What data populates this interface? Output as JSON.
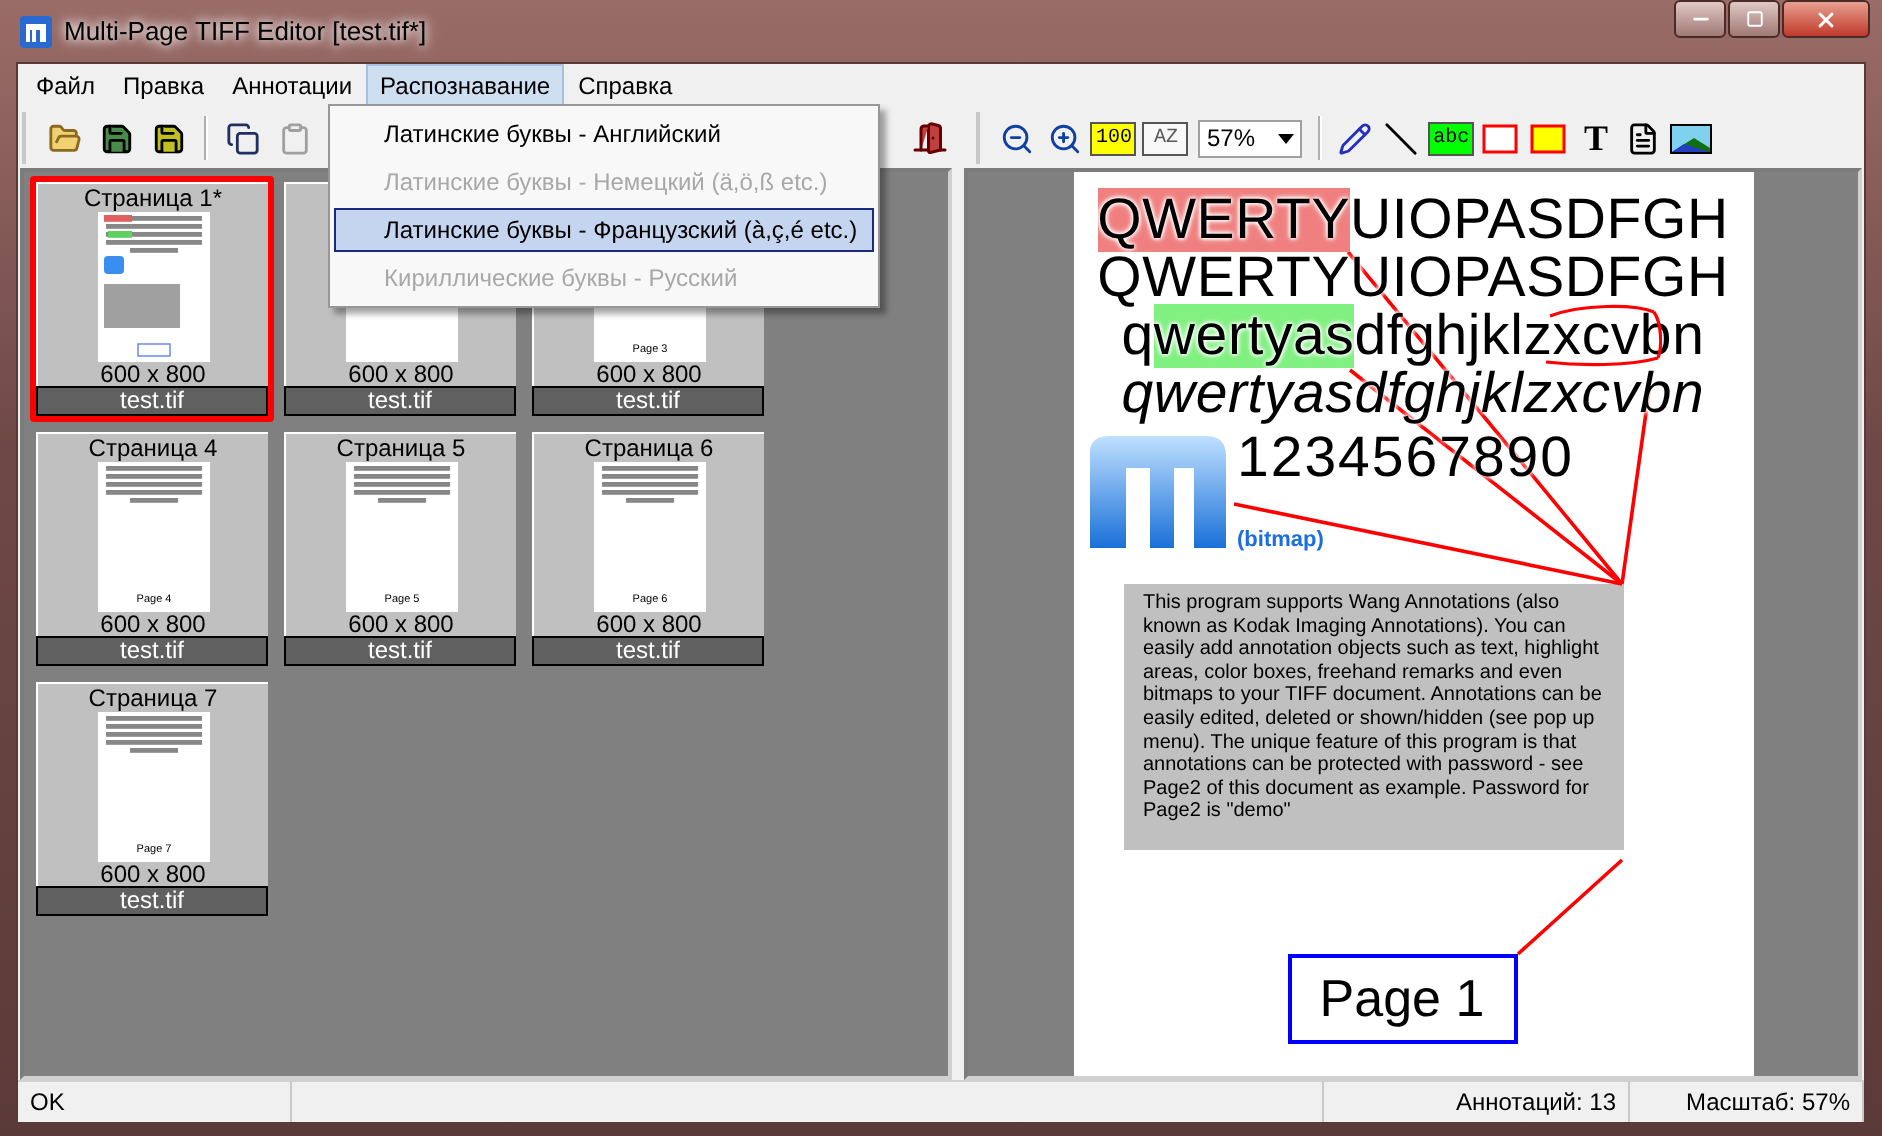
{
  "window": {
    "title": "Multi-Page TIFF Editor [test.tif*]"
  },
  "menu": [
    {
      "label": "Файл",
      "selected": false
    },
    {
      "label": "Правка",
      "selected": false
    },
    {
      "label": "Аннотации",
      "selected": false
    },
    {
      "label": "Распознавание",
      "selected": true
    },
    {
      "label": "Справка",
      "selected": false
    }
  ],
  "dropdown": [
    {
      "label": "Латинские буквы - Английский",
      "disabled": false,
      "selected": false
    },
    {
      "label": "Латинские буквы - Немецкий (ä,ö,ß etc.)",
      "disabled": true,
      "selected": false
    },
    {
      "label": "Латинские буквы - Французский (à,ç,é etc.)",
      "disabled": false,
      "selected": true
    },
    {
      "label": "Кириллические буквы - Русский",
      "disabled": true,
      "selected": false
    }
  ],
  "left_toolbar": [
    {
      "kind": "open",
      "disabled": false
    },
    {
      "kind": "save",
      "disabled": false
    },
    {
      "kind": "save-all",
      "disabled": false
    },
    {
      "kind": "copy",
      "disabled": false
    },
    {
      "kind": "paste",
      "disabled": true
    }
  ],
  "right_toolbar": [
    {
      "kind": "zoom-out",
      "disabled": false
    },
    {
      "kind": "zoom-in",
      "disabled": false
    },
    {
      "kind": "actual-size",
      "label": "100",
      "disabled": false
    },
    {
      "kind": "fit",
      "label": "AZ",
      "disabled": true
    },
    {
      "kind": "combo",
      "value": "57%",
      "disabled": false
    },
    {
      "kind": "pen",
      "disabled": false
    },
    {
      "kind": "line",
      "disabled": false
    },
    {
      "kind": "highlight",
      "label": "abc",
      "disabled": false
    },
    {
      "kind": "hollow-rect",
      "disabled": false
    },
    {
      "kind": "filled-rect",
      "disabled": false
    },
    {
      "kind": "text",
      "label": "T",
      "disabled": false
    },
    {
      "kind": "note",
      "disabled": false
    },
    {
      "kind": "image",
      "disabled": false
    }
  ],
  "thumbnails": [
    {
      "title": "Страница 1*",
      "size": "600 x 800",
      "file": "test.tif",
      "selected": true,
      "kind": "annotated"
    },
    {
      "size": "600 x 800",
      "file": "test.tif",
      "selected": false,
      "kind": "plain"
    },
    {
      "caption": "Page 3",
      "size": "600 x 800",
      "file": "test.tif",
      "selected": false,
      "kind": "plain"
    },
    {
      "title": "Страница 4",
      "caption": "Page 4",
      "size": "600 x 800",
      "file": "test.tif",
      "selected": false,
      "kind": "plain"
    },
    {
      "title": "Страница 5",
      "caption": "Page 5",
      "size": "600 x 800",
      "file": "test.tif",
      "selected": false,
      "kind": "plain"
    },
    {
      "title": "Страница 6",
      "caption": "Page 6",
      "size": "600 x 800",
      "file": "test.tif",
      "selected": false,
      "kind": "plain"
    },
    {
      "title": "Страница 7",
      "caption": "Page 7",
      "size": "600 x 800",
      "file": "test.tif",
      "selected": false,
      "kind": "plain"
    }
  ],
  "document": {
    "rows": [
      {
        "kind": "plain",
        "segments": [
          {
            "text": "QWERTY",
            "kind": "highlight",
            "color": "#f08080"
          },
          {
            "text": "UIOPASDFGH",
            "kind": "plain"
          }
        ]
      },
      {
        "kind": "plain",
        "segments": [
          {
            "text": "QWERTYUIOPASDFGH",
            "kind": "plain"
          }
        ]
      },
      {
        "kind": "plain",
        "segments": [
          {
            "text": "q",
            "kind": "plain"
          },
          {
            "text": "wertyas",
            "kind": "highlight",
            "color": "#80f080"
          },
          {
            "text": "dfghjklz",
            "kind": "plain"
          },
          {
            "text": "xcvb",
            "kind": "scribble"
          },
          {
            "text": "n",
            "kind": "plain"
          }
        ]
      },
      {
        "kind": "italic",
        "segments": [
          {
            "text": "qwertyasdfghjklzxcvbn",
            "kind": "plain"
          }
        ]
      }
    ],
    "digits": "1234567890",
    "bitmap_caption": "(bitmap)",
    "note": "This program supports Wang Annotations (also known as Kodak Imaging Annotations). You can easily add annotation objects such as text, highlight areas, color boxes, freehand remarks and even bitmaps to your TIFF document. Annotations can be easily edited, deleted or shown/hidden (see pop up menu). The unique feature of this program is that annotations can be protected with password - see Page2 of this document as example. Password for Page2 is \"demo\"",
    "stamp": "Page 1"
  },
  "status_bar": {
    "message": "OK",
    "annotations": "Аннотаций: 13",
    "zoom": "Масштаб: 57%"
  }
}
